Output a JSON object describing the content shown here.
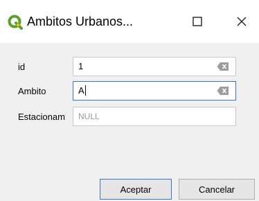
{
  "window": {
    "title": "Ambitos Urbanos...",
    "icon": "qgis-logo-icon",
    "maximize_icon": "maximize-icon",
    "close_icon": "close-icon"
  },
  "form": {
    "fields": [
      {
        "label": "id",
        "value": "1",
        "placeholder": "",
        "has_clear": true
      },
      {
        "label": "Ambito",
        "value": "A",
        "placeholder": "",
        "has_clear": true,
        "focused": true
      },
      {
        "label": "Estacionam",
        "value": "",
        "placeholder": "NULL",
        "has_clear": false
      }
    ]
  },
  "buttons": {
    "ok_label": "Aceptar",
    "cancel_label": "Cancelar"
  },
  "colors": {
    "qgis_green": "#5aa02c",
    "qgis_yellow": "#f0c419",
    "focus_border": "#3a74c4"
  }
}
